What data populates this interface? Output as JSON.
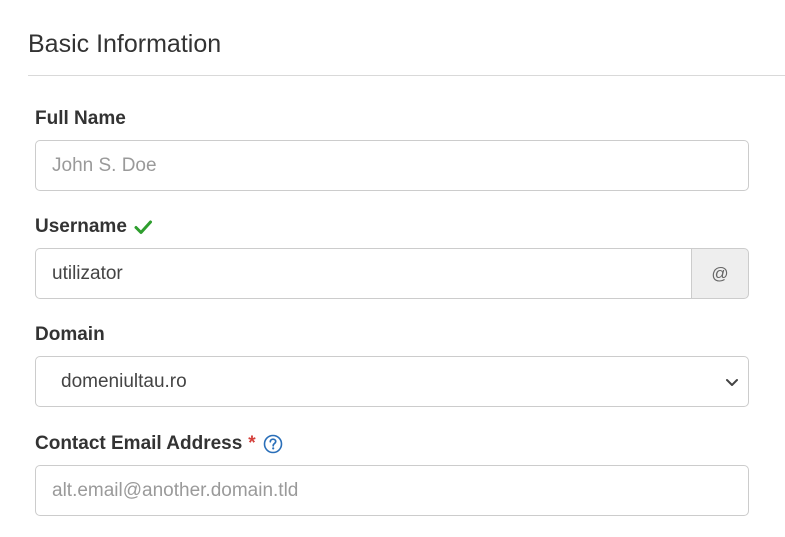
{
  "section": {
    "title": "Basic Information"
  },
  "fields": {
    "full_name": {
      "label": "Full Name",
      "placeholder": "John S. Doe",
      "value": ""
    },
    "username": {
      "label": "Username",
      "value": "utilizator",
      "addon": "@",
      "status_icon": "check-icon",
      "status_color": "#2e9e2e"
    },
    "domain": {
      "label": "Domain",
      "selected": "domeniultau.ro",
      "icon": "chevron-down-icon"
    },
    "contact_email": {
      "label": "Contact Email Address",
      "required_mark": "*",
      "help_icon": "question-circle-icon",
      "placeholder": "alt.email@another.domain.tld",
      "value": ""
    }
  },
  "colors": {
    "required": "#d43f3a",
    "help": "#2a6fb9",
    "check": "#2e9e2e"
  }
}
